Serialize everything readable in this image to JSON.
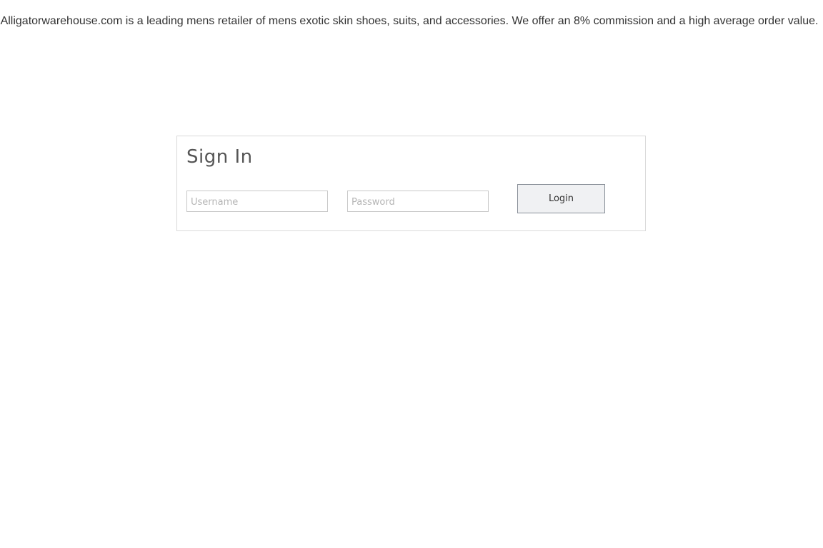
{
  "intro": {
    "text": "Alligatorwarehouse.com is a leading mens retailer of mens exotic skin shoes, suits, and accessories. We offer an 8% commission and a high average order value."
  },
  "signin": {
    "title": "Sign In",
    "username": {
      "value": "",
      "placeholder": "Username"
    },
    "password": {
      "value": "",
      "placeholder": "Password"
    },
    "login_label": "Login"
  }
}
